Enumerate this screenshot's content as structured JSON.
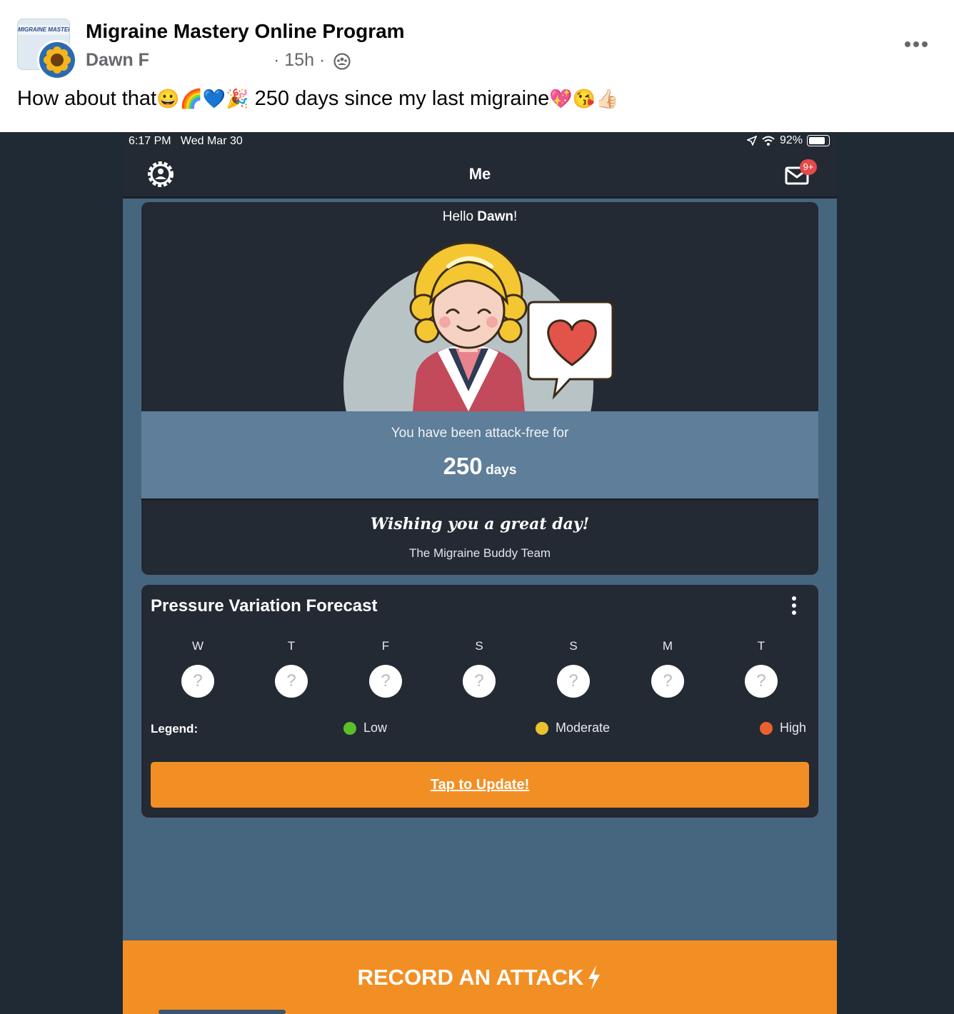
{
  "post": {
    "group_name": "Migraine Mastery Online Program",
    "author": "Dawn F",
    "time": "· 15h ·",
    "thumb_text": "MIGRAINE MASTERY",
    "text_start": "How about that",
    "emoji_group1": "😀🌈💙🎉",
    "text_middle": " 250 days since my last migraine",
    "emoji_group2": "💖😘👍🏻"
  },
  "status_bar": {
    "time": "6:17 PM   Wed Mar 30",
    "battery": "92%"
  },
  "app_bar": {
    "title": "Me",
    "badge": "9+"
  },
  "hello_card": {
    "greeting_prefix": "Hello ",
    "name": "Dawn",
    "greeting_suffix": "!",
    "attack_free_label": "You have been attack-free for",
    "days_value": "250",
    "days_unit": "days",
    "wish": "Wishing you a great day!",
    "team": "The Migraine Buddy Team"
  },
  "forecast": {
    "title": "Pressure Variation Forecast",
    "days": [
      {
        "label": "W",
        "value": "?"
      },
      {
        "label": "T",
        "value": "?"
      },
      {
        "label": "F",
        "value": "?"
      },
      {
        "label": "S",
        "value": "?"
      },
      {
        "label": "S",
        "value": "?"
      },
      {
        "label": "M",
        "value": "?"
      },
      {
        "label": "T",
        "value": "?"
      }
    ],
    "legend_label": "Legend:",
    "legend": [
      {
        "label": "Low",
        "color": "#5bbf2a"
      },
      {
        "label": "Moderate",
        "color": "#e9c22e"
      },
      {
        "label": "High",
        "color": "#e9622e"
      }
    ],
    "update_button": "Tap to Update!"
  },
  "record_button": "RECORD AN ATTACK",
  "colors": {
    "accent_orange": "#f28f24",
    "card_bg": "#232a33",
    "screen_bg": "#46657f",
    "band_bg": "#5e7e99"
  }
}
